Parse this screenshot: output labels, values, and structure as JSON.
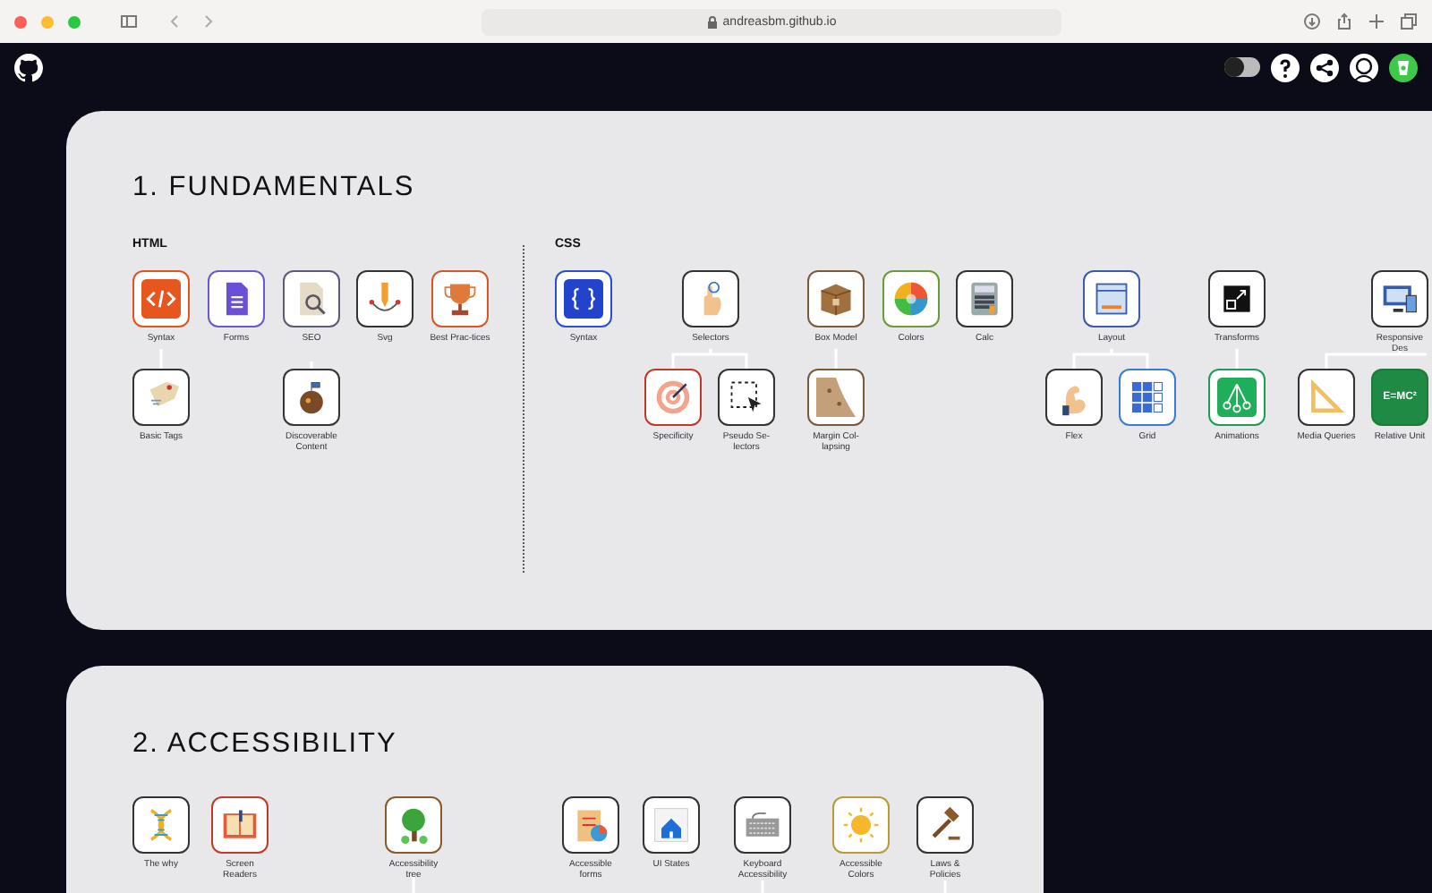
{
  "browser": {
    "url": "andreasbm.github.io"
  },
  "header": {
    "theme_toggle": {
      "on": false
    }
  },
  "sections": [
    {
      "title": "1. FUNDAMENTALS",
      "groups": [
        {
          "heading": "HTML",
          "nodes": [
            {
              "label": "Syntax"
            },
            {
              "label": "Forms"
            },
            {
              "label": "SEO"
            },
            {
              "label": "Svg"
            },
            {
              "label": "Best Prac-tices"
            },
            {
              "label": "Basic Tags"
            },
            {
              "label": "Discoverable Content"
            }
          ]
        },
        {
          "heading": "CSS",
          "nodes": [
            {
              "label": "Syntax"
            },
            {
              "label": "Selectors"
            },
            {
              "label": "Box Model"
            },
            {
              "label": "Colors"
            },
            {
              "label": "Calc"
            },
            {
              "label": "Layout"
            },
            {
              "label": "Transforms"
            },
            {
              "label": "Responsive Des"
            },
            {
              "label": "Specificity"
            },
            {
              "label": "Pseudo Se-lectors"
            },
            {
              "label": "Margin Col-lapsing"
            },
            {
              "label": "Flex"
            },
            {
              "label": "Grid"
            },
            {
              "label": "Animations"
            },
            {
              "label": "Media Queries"
            },
            {
              "label": "Relative Unit",
              "icon_text": "E=MC²"
            }
          ]
        }
      ]
    },
    {
      "title": "2. ACCESSIBILITY",
      "groups": [
        {
          "nodes": [
            {
              "label": "The why"
            },
            {
              "label": "Screen Readers"
            },
            {
              "label": "Accessibility tree"
            },
            {
              "label": "Accessible forms"
            },
            {
              "label": "UI States"
            },
            {
              "label": "Keyboard Accessibility"
            },
            {
              "label": "Accessible Colors"
            },
            {
              "label": "Laws & Policies"
            }
          ]
        }
      ]
    }
  ]
}
